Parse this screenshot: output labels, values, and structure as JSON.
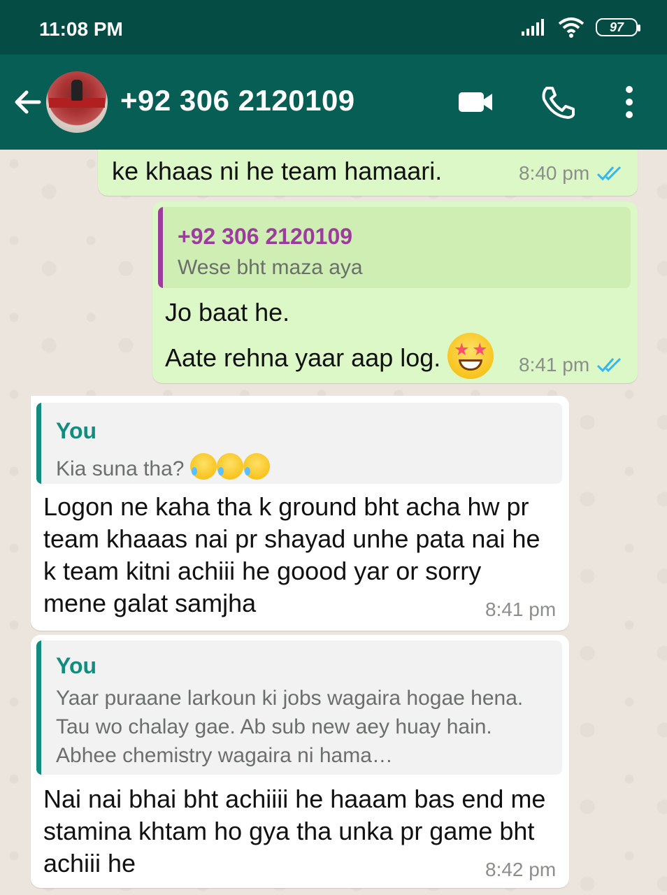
{
  "status_bar": {
    "time": "11:08 PM",
    "battery": "97"
  },
  "header": {
    "contact": "+92 306 2120109",
    "icons": {
      "back": "arrow-left-icon",
      "video": "video-camera-icon",
      "call": "phone-icon",
      "menu": "more-vertical-icon"
    }
  },
  "messages": [
    {
      "direction": "outgoing",
      "text": "ke khaas ni he team hamaari.",
      "time": "8:40 pm",
      "ticks": "double-blue"
    },
    {
      "direction": "outgoing",
      "quote_name": "+92 306 2120109",
      "quote_text": "Wese bht maza aya",
      "text_line1": "Jo baat he.",
      "text_line2": "Aate rehna yaar aap log.",
      "emoji": "star-struck",
      "time": "8:41 pm",
      "ticks": "double-blue"
    },
    {
      "direction": "incoming",
      "quote_name": "You",
      "quote_text": "Kia suna tha?",
      "quote_emoji": "rolling-on-floor-laughing x3",
      "text": "Logon ne kaha tha k ground bht acha hw pr team khaaas nai pr shayad unhe pata nai he k team kitni achiii he goood yar or sorry mene galat samjha",
      "time": "8:41 pm"
    },
    {
      "direction": "incoming",
      "quote_name": "You",
      "quote_text": "Yaar puraane larkoun ki jobs wagaira hogae hena. Tau wo chalay gae. Ab sub new aey huay hain. Abhee chemistry wagaira ni hama…",
      "text": "Nai nai bhai bht achiiii he haaam bas end me stamina khtam ho gya tha unka pr game bht achiii he",
      "time": "8:42 pm"
    }
  ],
  "colors": {
    "header": "#075e54",
    "status_bar": "#054d44",
    "outgoing": "#dcf8c6",
    "incoming": "#ffffff",
    "quote_you": "#128c7e",
    "quote_contact": "#9c3c9c",
    "tick_read": "#34b7f1"
  }
}
